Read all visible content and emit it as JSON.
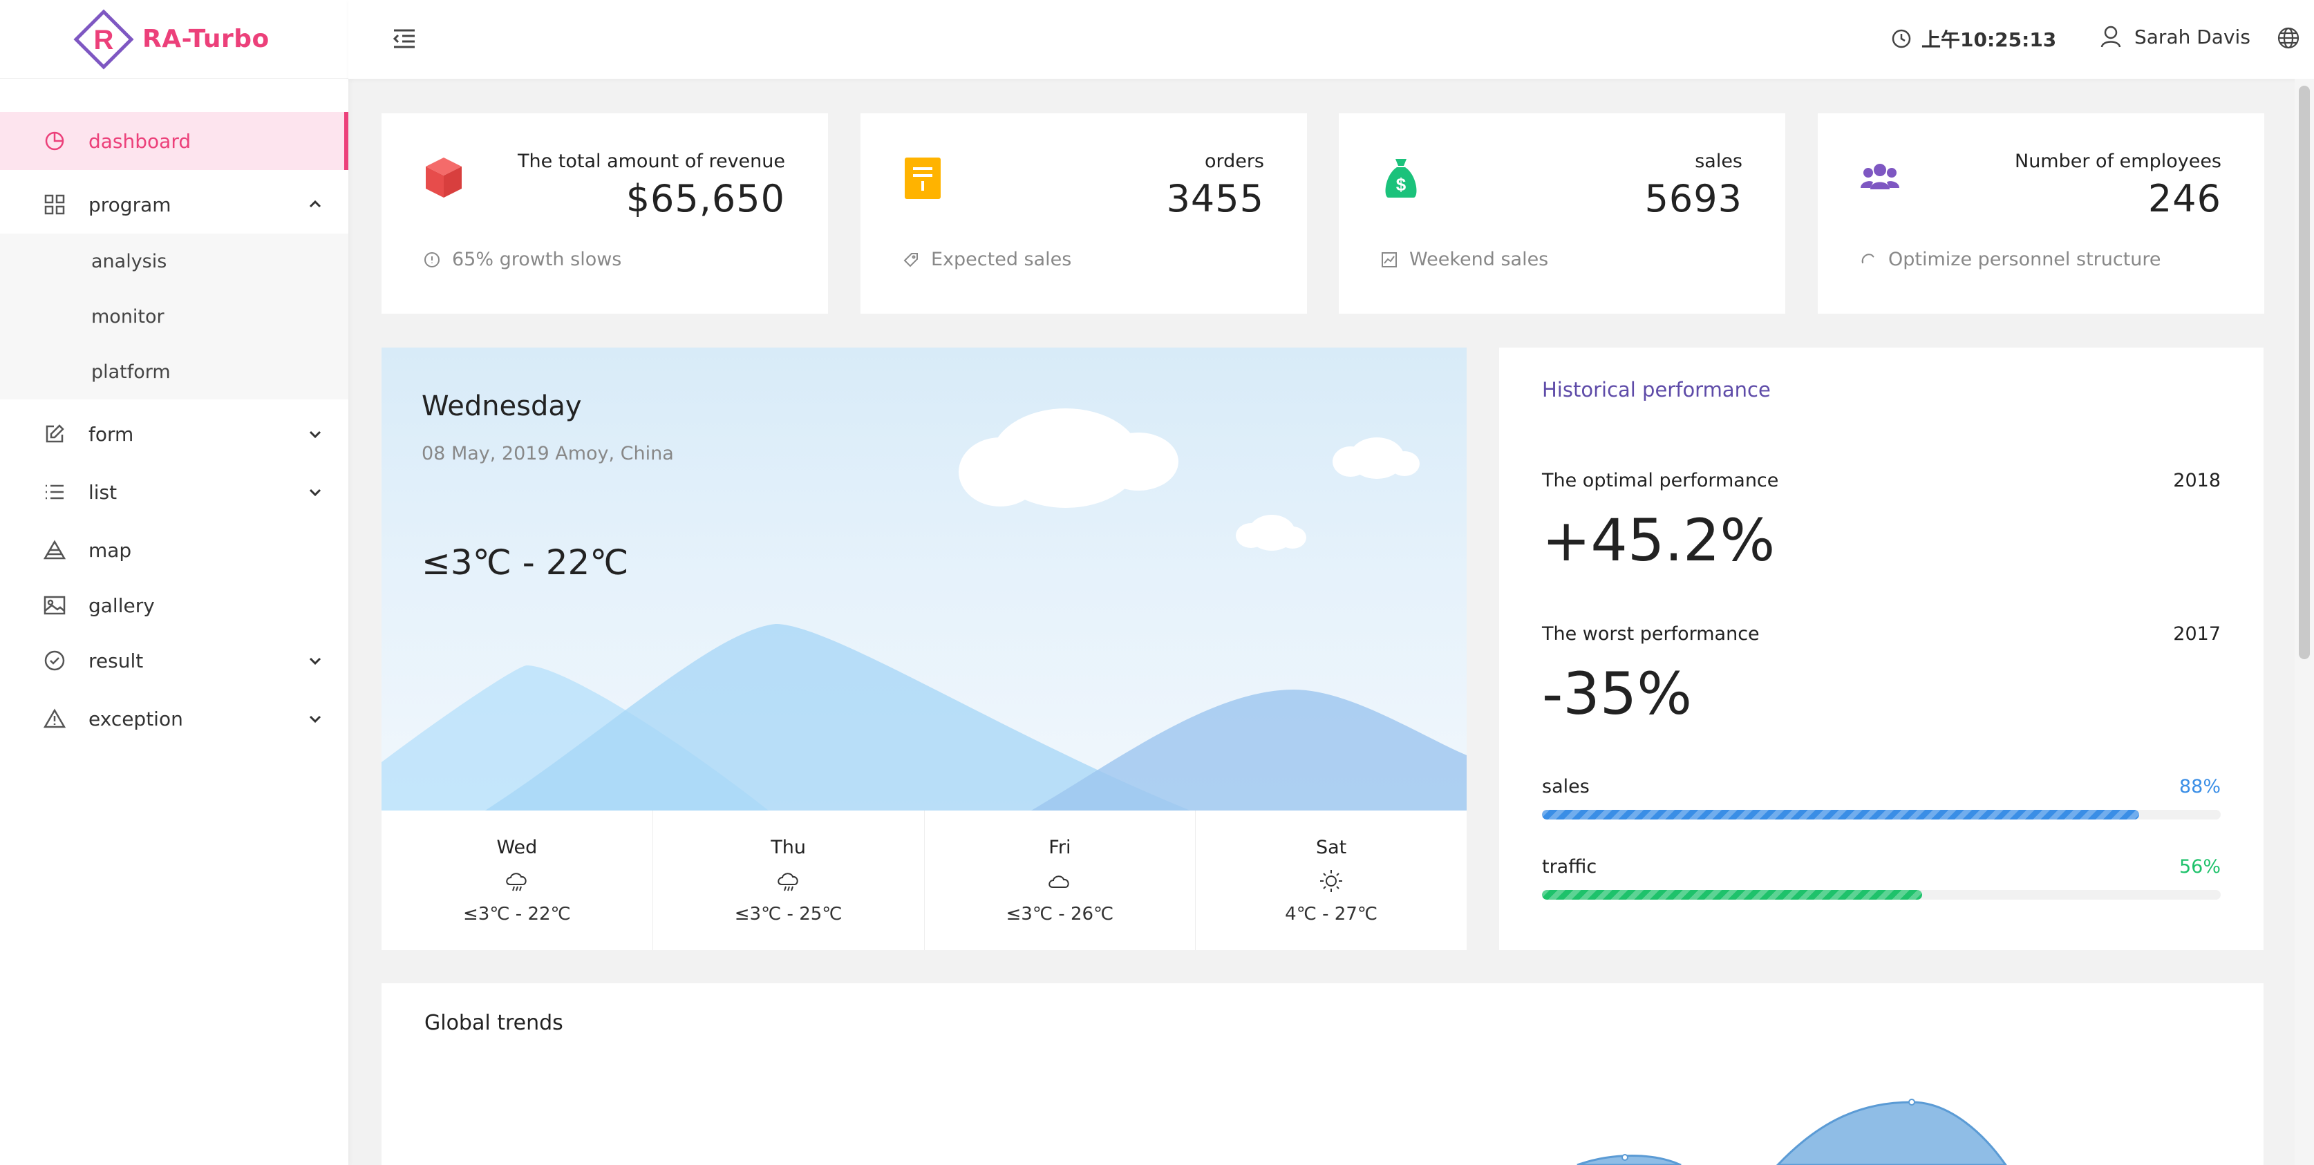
{
  "brand": {
    "name": "RA-Turbo"
  },
  "sidebar": {
    "items": [
      {
        "label": "dashboard",
        "icon": "pie-chart-icon",
        "active": true
      },
      {
        "label": "program",
        "icon": "grid-icon",
        "expanded": true,
        "children": [
          {
            "label": "analysis"
          },
          {
            "label": "monitor"
          },
          {
            "label": "platform"
          }
        ]
      },
      {
        "label": "form",
        "icon": "edit-icon"
      },
      {
        "label": "list",
        "icon": "list-icon"
      },
      {
        "label": "map",
        "icon": "map-icon"
      },
      {
        "label": "gallery",
        "icon": "image-icon"
      },
      {
        "label": "result",
        "icon": "check-circle-icon"
      },
      {
        "label": "exception",
        "icon": "warning-icon"
      }
    ]
  },
  "header": {
    "time": "上午10:25:13",
    "user": "Sarah Davis"
  },
  "stats": [
    {
      "title": "The total amount of revenue",
      "value": "$65,650",
      "footer": "65% growth slows",
      "icon": "cube-icon",
      "color": "#f0504f"
    },
    {
      "title": "orders",
      "value": "3455",
      "footer": "Expected sales",
      "icon": "document-icon",
      "color": "#ffb300"
    },
    {
      "title": "sales",
      "value": "5693",
      "footer": "Weekend sales",
      "icon": "money-bag-icon",
      "color": "#1bc27b"
    },
    {
      "title": "Number of employees",
      "value": "246",
      "footer": "Optimize personnel structure",
      "icon": "users-icon",
      "color": "#7e57c2"
    }
  ],
  "weather": {
    "day": "Wednesday",
    "date": "08 May, 2019 Amoy, China",
    "range": "≤3℃ - 22℃",
    "forecast": [
      {
        "day": "Wed",
        "icon": "rain-cloud-icon",
        "range": "≤3℃ - 22℃"
      },
      {
        "day": "Thu",
        "icon": "rain-cloud-icon",
        "range": "≤3℃ - 25℃"
      },
      {
        "day": "Fri",
        "icon": "cloud-icon",
        "range": "≤3℃ - 26℃"
      },
      {
        "day": "Sat",
        "icon": "sun-icon",
        "range": "4℃ - 27℃"
      }
    ]
  },
  "performance": {
    "title": "Historical performance",
    "optimal": {
      "label": "The optimal performance",
      "year": "2018",
      "value": "+45.2%"
    },
    "worst": {
      "label": "The worst performance",
      "year": "2017",
      "value": "-35%"
    },
    "bars": [
      {
        "label": "sales",
        "percent": "88%",
        "value": 0.88,
        "color": "#3a8ee6"
      },
      {
        "label": "traffic",
        "percent": "56%",
        "value": 0.56,
        "color": "#1ec26b"
      }
    ]
  },
  "trends": {
    "title": "Global trends"
  }
}
